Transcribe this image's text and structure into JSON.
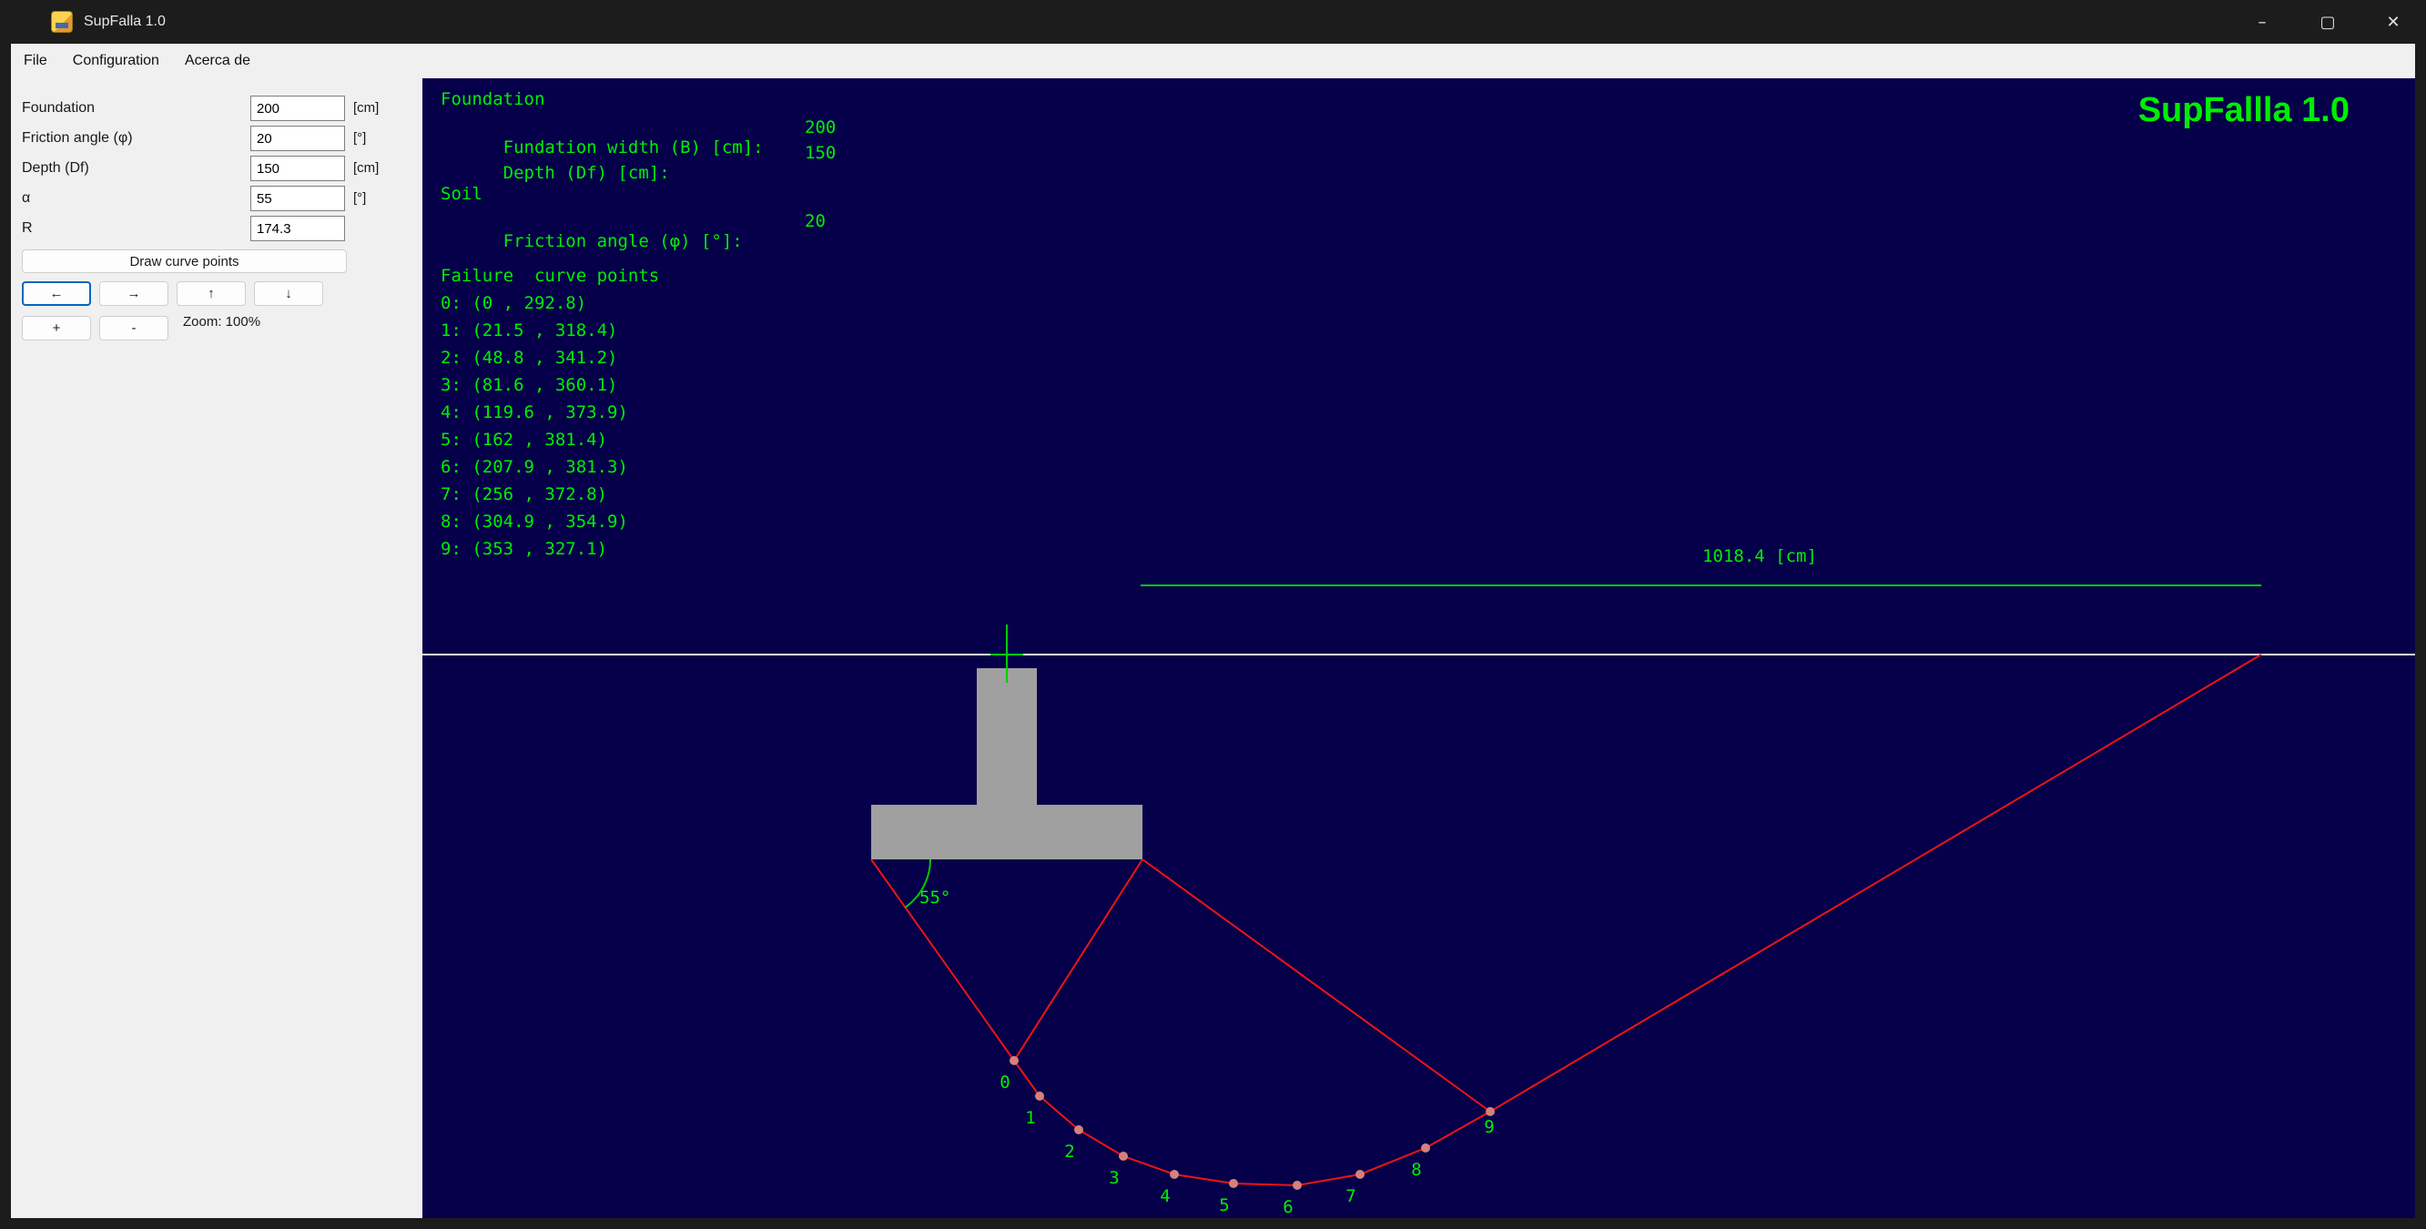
{
  "window": {
    "title": "SupFalla 1.0"
  },
  "titlebar": {
    "minimize_glyph": "–",
    "maximize_glyph": "▢",
    "close_glyph": "✕"
  },
  "menu": {
    "items": [
      "File",
      "Configuration",
      "Acerca de"
    ]
  },
  "sidebar": {
    "fields": [
      {
        "label": "Foundation",
        "value": "200",
        "unit": "[cm]"
      },
      {
        "label": "Friction angle (φ)",
        "value": "20",
        "unit": "[°]"
      },
      {
        "label": "Depth (Df)",
        "value": "150",
        "unit": "[cm]"
      },
      {
        "label": "α",
        "value": "55",
        "unit": "[°]"
      },
      {
        "label": "R",
        "value": "174.3",
        "unit": ""
      }
    ],
    "draw_button_label": "Draw curve points",
    "pan": [
      "←",
      "→",
      "↑",
      "↓"
    ],
    "zoom_in": "+",
    "zoom_out": "-",
    "zoom_label": "Zoom: 100%"
  },
  "canvas": {
    "watermark": "SupFallla 1.0",
    "foundation_section": {
      "header": "Foundation",
      "rows": [
        {
          "label": "Fundation width (B) [cm]:",
          "value": "200"
        },
        {
          "label": "Depth (Df) [cm]:",
          "value": "150"
        }
      ]
    },
    "soil_section": {
      "header": "Soil",
      "rows": [
        {
          "label": "Friction angle (φ) [°]:",
          "value": "20"
        }
      ]
    },
    "curve_section": {
      "header": "Failure  curve points",
      "points": [
        "0: (0 , 292.8)",
        "1: (21.5 , 318.4)",
        "2: (48.8 , 341.2)",
        "3: (81.6 , 360.1)",
        "4: (119.6 , 373.9)",
        "5: (162 , 381.4)",
        "6: (207.9 , 381.3)",
        "7: (256 , 372.8)",
        "8: (304.9 , 354.9)",
        "9: (353 , 327.1)"
      ]
    },
    "scale_label": "1018.4 [cm]",
    "angle_label": "55°",
    "point_labels": [
      "0",
      "1",
      "2",
      "3",
      "4",
      "5",
      "6",
      "7",
      "8",
      "9"
    ],
    "colors": {
      "background": "#050049",
      "accent_green": "#00ee00",
      "line_red": "#ee1414",
      "foundation_gray": "#a0a0a0",
      "ground_line": "#e8e8e8"
    }
  }
}
